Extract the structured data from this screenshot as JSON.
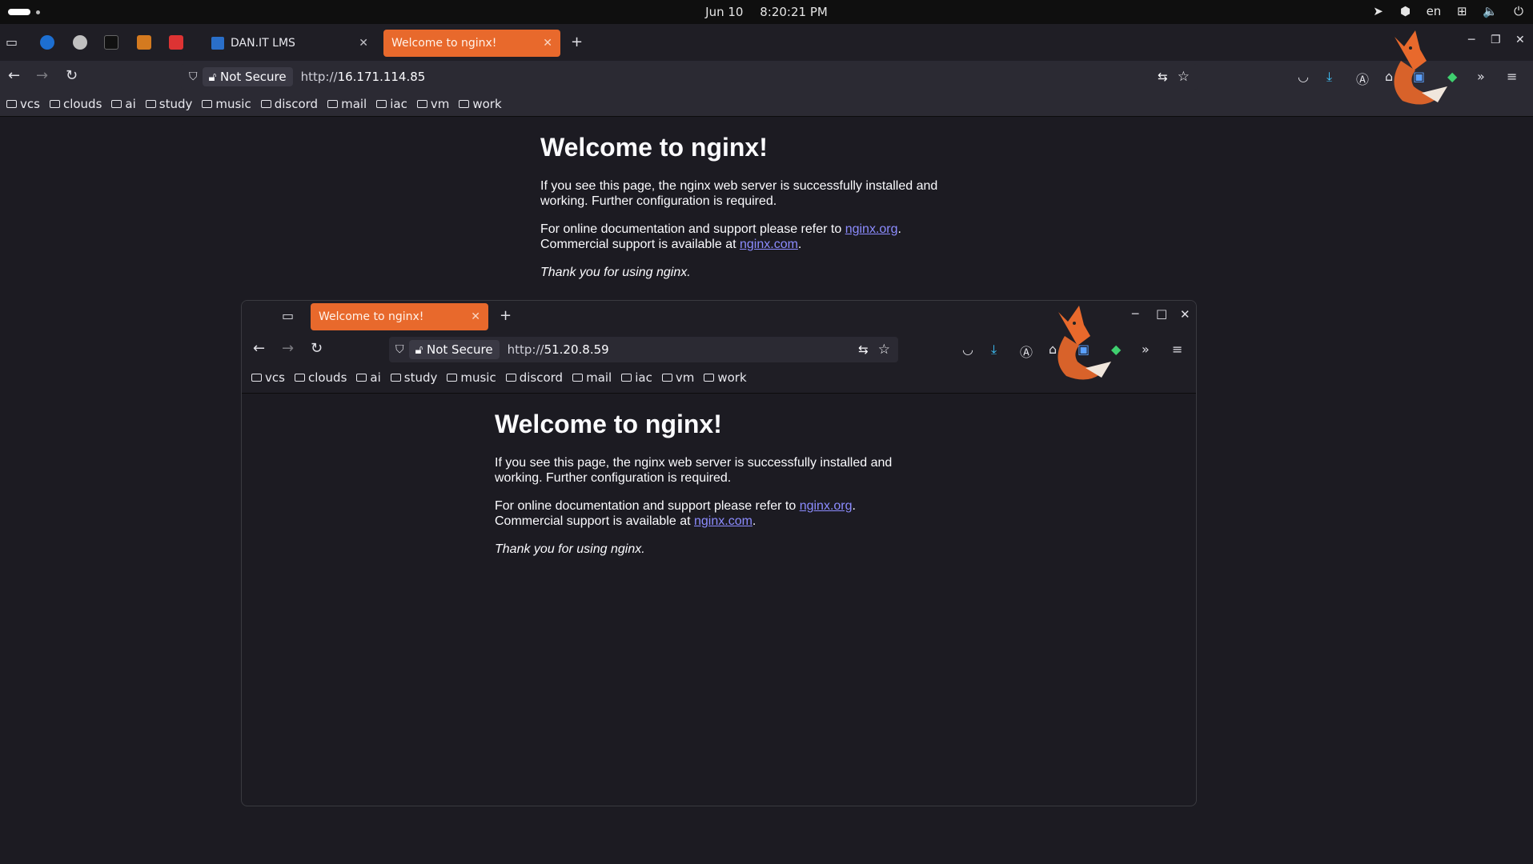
{
  "topbar": {
    "date": "Jun 10",
    "time": "8:20:21 PM",
    "lang": "en"
  },
  "outer": {
    "tabs": [
      {
        "label": "DAN.IT LMS"
      },
      {
        "label": "Welcome to nginx!"
      }
    ],
    "not_secure": "Not Secure",
    "url_prefix": "http://",
    "url_host": "16.171.114.85",
    "bookmarks": [
      "vcs",
      "clouds",
      "ai",
      "study",
      "music",
      "discord",
      "mail",
      "iac",
      "vm",
      "work"
    ]
  },
  "inner": {
    "tab_label": "Welcome to nginx!",
    "not_secure": "Not Secure",
    "url_prefix": "http://",
    "url_host": "51.20.8.59",
    "bookmarks": [
      "vcs",
      "clouds",
      "ai",
      "study",
      "music",
      "discord",
      "mail",
      "iac",
      "vm",
      "work"
    ]
  },
  "page": {
    "title": "Welcome to nginx!",
    "p1": "If you see this page, the nginx web server is successfully installed and working. Further configuration is required.",
    "p2_pre": "For online documentation and support please refer to ",
    "p2_link1": "nginx.org",
    "p2_mid": ".\nCommercial support is available at ",
    "p2_link2": "nginx.com",
    "p2_end": ".",
    "p3": "Thank you for using nginx."
  },
  "colors": {
    "accent_tab": "#e8692c",
    "link": "#8c8cff",
    "background": "#1c1b22"
  }
}
